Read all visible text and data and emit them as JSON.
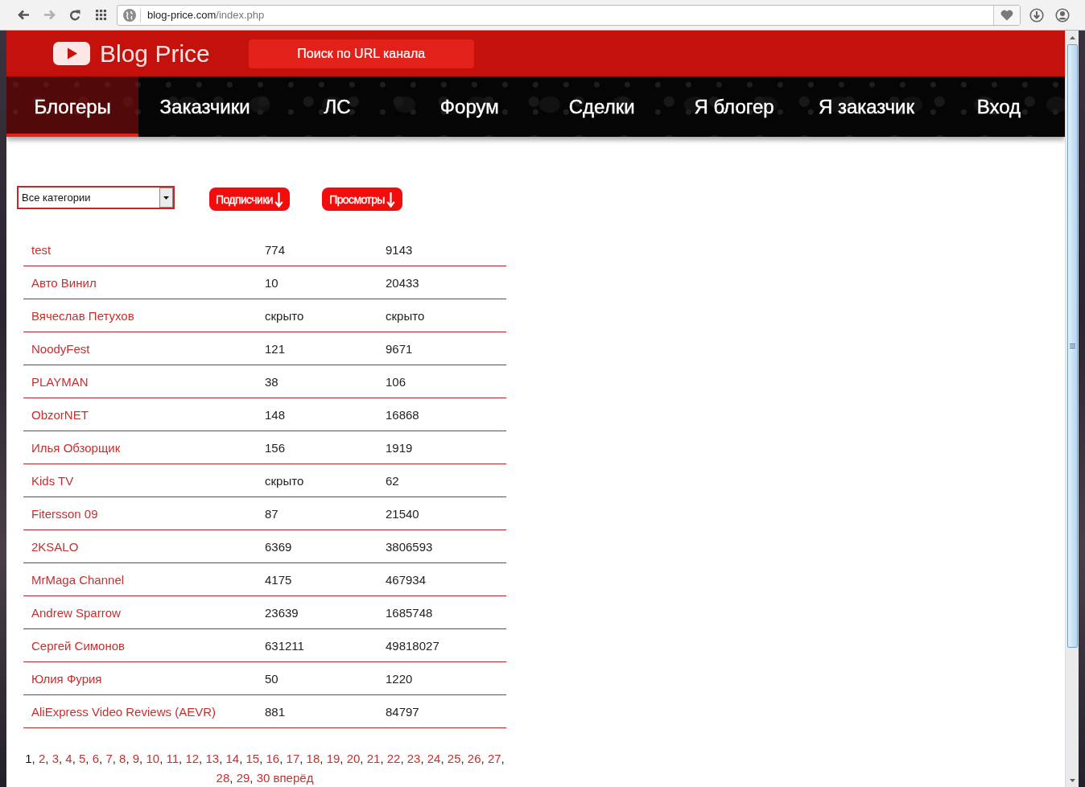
{
  "browser": {
    "url_host": "blog-price.com",
    "url_path": "/index.php",
    "forward_disabled": true
  },
  "header": {
    "logo_text": "Blog Price",
    "search_button": "Поиск по URL канала"
  },
  "nav": [
    {
      "label": "Блогеры",
      "selected": true
    },
    {
      "label": "Заказчики",
      "selected": false
    },
    {
      "label": "ЛС",
      "selected": false
    },
    {
      "label": "Форум",
      "selected": false
    },
    {
      "label": "Сделки",
      "selected": false
    },
    {
      "label": "Я блогер",
      "selected": false
    },
    {
      "label": "Я заказчик",
      "selected": false
    },
    {
      "label": "Вход",
      "selected": false
    }
  ],
  "filters": {
    "category": "Все категории",
    "sort_buttons": [
      "Подписчики",
      "Просмотры"
    ]
  },
  "table": {
    "rows": [
      {
        "cells": [
          "test",
          "774",
          "9143"
        ]
      },
      {
        "cells": [
          "Авто Винил",
          "10",
          "20433"
        ]
      },
      {
        "cells": [
          "Вячеслав Петухов",
          "скрыто",
          "скрыто"
        ]
      },
      {
        "cells": [
          "NoodyFest",
          "121",
          "9671"
        ]
      },
      {
        "cells": [
          "PLAYMAN",
          "38",
          "106"
        ]
      },
      {
        "cells": [
          "ObzorNET",
          "148",
          "16868"
        ]
      },
      {
        "cells": [
          "Илья Обзорщик",
          "156",
          "1919"
        ]
      },
      {
        "cells": [
          "Kids TV",
          "скрыто",
          "62"
        ]
      },
      {
        "cells": [
          "Fitersson 09",
          "87",
          "21540"
        ]
      },
      {
        "cells": [
          "2KSALO",
          "6369",
          "3806593"
        ]
      },
      {
        "cells": [
          "MrMaga Channel",
          "4175",
          "467934"
        ]
      },
      {
        "cells": [
          "Andrew Sparrow",
          "23639",
          "1685748"
        ]
      },
      {
        "cells": [
          "Сергей Симонов",
          "631211",
          "49818027"
        ]
      },
      {
        "cells": [
          "Юлия Фурия",
          "50",
          "1220"
        ]
      },
      {
        "cells": [
          "AliExpress Video Reviews (AEVR)",
          "881",
          "84797"
        ]
      }
    ]
  },
  "pagination": {
    "pages": [
      {
        "label": "1",
        "selected": true
      },
      {
        "label": "2",
        "selected": false
      },
      {
        "label": "3",
        "selected": false
      },
      {
        "label": "4",
        "selected": false
      },
      {
        "label": "5",
        "selected": false
      },
      {
        "label": "6",
        "selected": false
      },
      {
        "label": "7",
        "selected": false
      },
      {
        "label": "8",
        "selected": false
      },
      {
        "label": "9",
        "selected": false
      },
      {
        "label": "10",
        "selected": false
      },
      {
        "label": "11",
        "selected": false
      },
      {
        "label": "12",
        "selected": false
      },
      {
        "label": "13",
        "selected": false
      },
      {
        "label": "14",
        "selected": false
      },
      {
        "label": "15",
        "selected": false
      },
      {
        "label": "16",
        "selected": false
      },
      {
        "label": "17",
        "selected": false
      },
      {
        "label": "18",
        "selected": false
      },
      {
        "label": "19",
        "selected": false
      },
      {
        "label": "20",
        "selected": false
      },
      {
        "label": "21",
        "selected": false
      },
      {
        "label": "22",
        "selected": false
      },
      {
        "label": "23",
        "selected": false
      },
      {
        "label": "24",
        "selected": false
      },
      {
        "label": "25",
        "selected": false
      },
      {
        "label": "26",
        "selected": false
      },
      {
        "label": "27",
        "selected": false
      },
      {
        "label": "28",
        "selected": false
      },
      {
        "label": "29",
        "selected": false
      },
      {
        "label": "30",
        "selected": false
      }
    ],
    "separator": ",",
    "next": "вперёд"
  }
}
